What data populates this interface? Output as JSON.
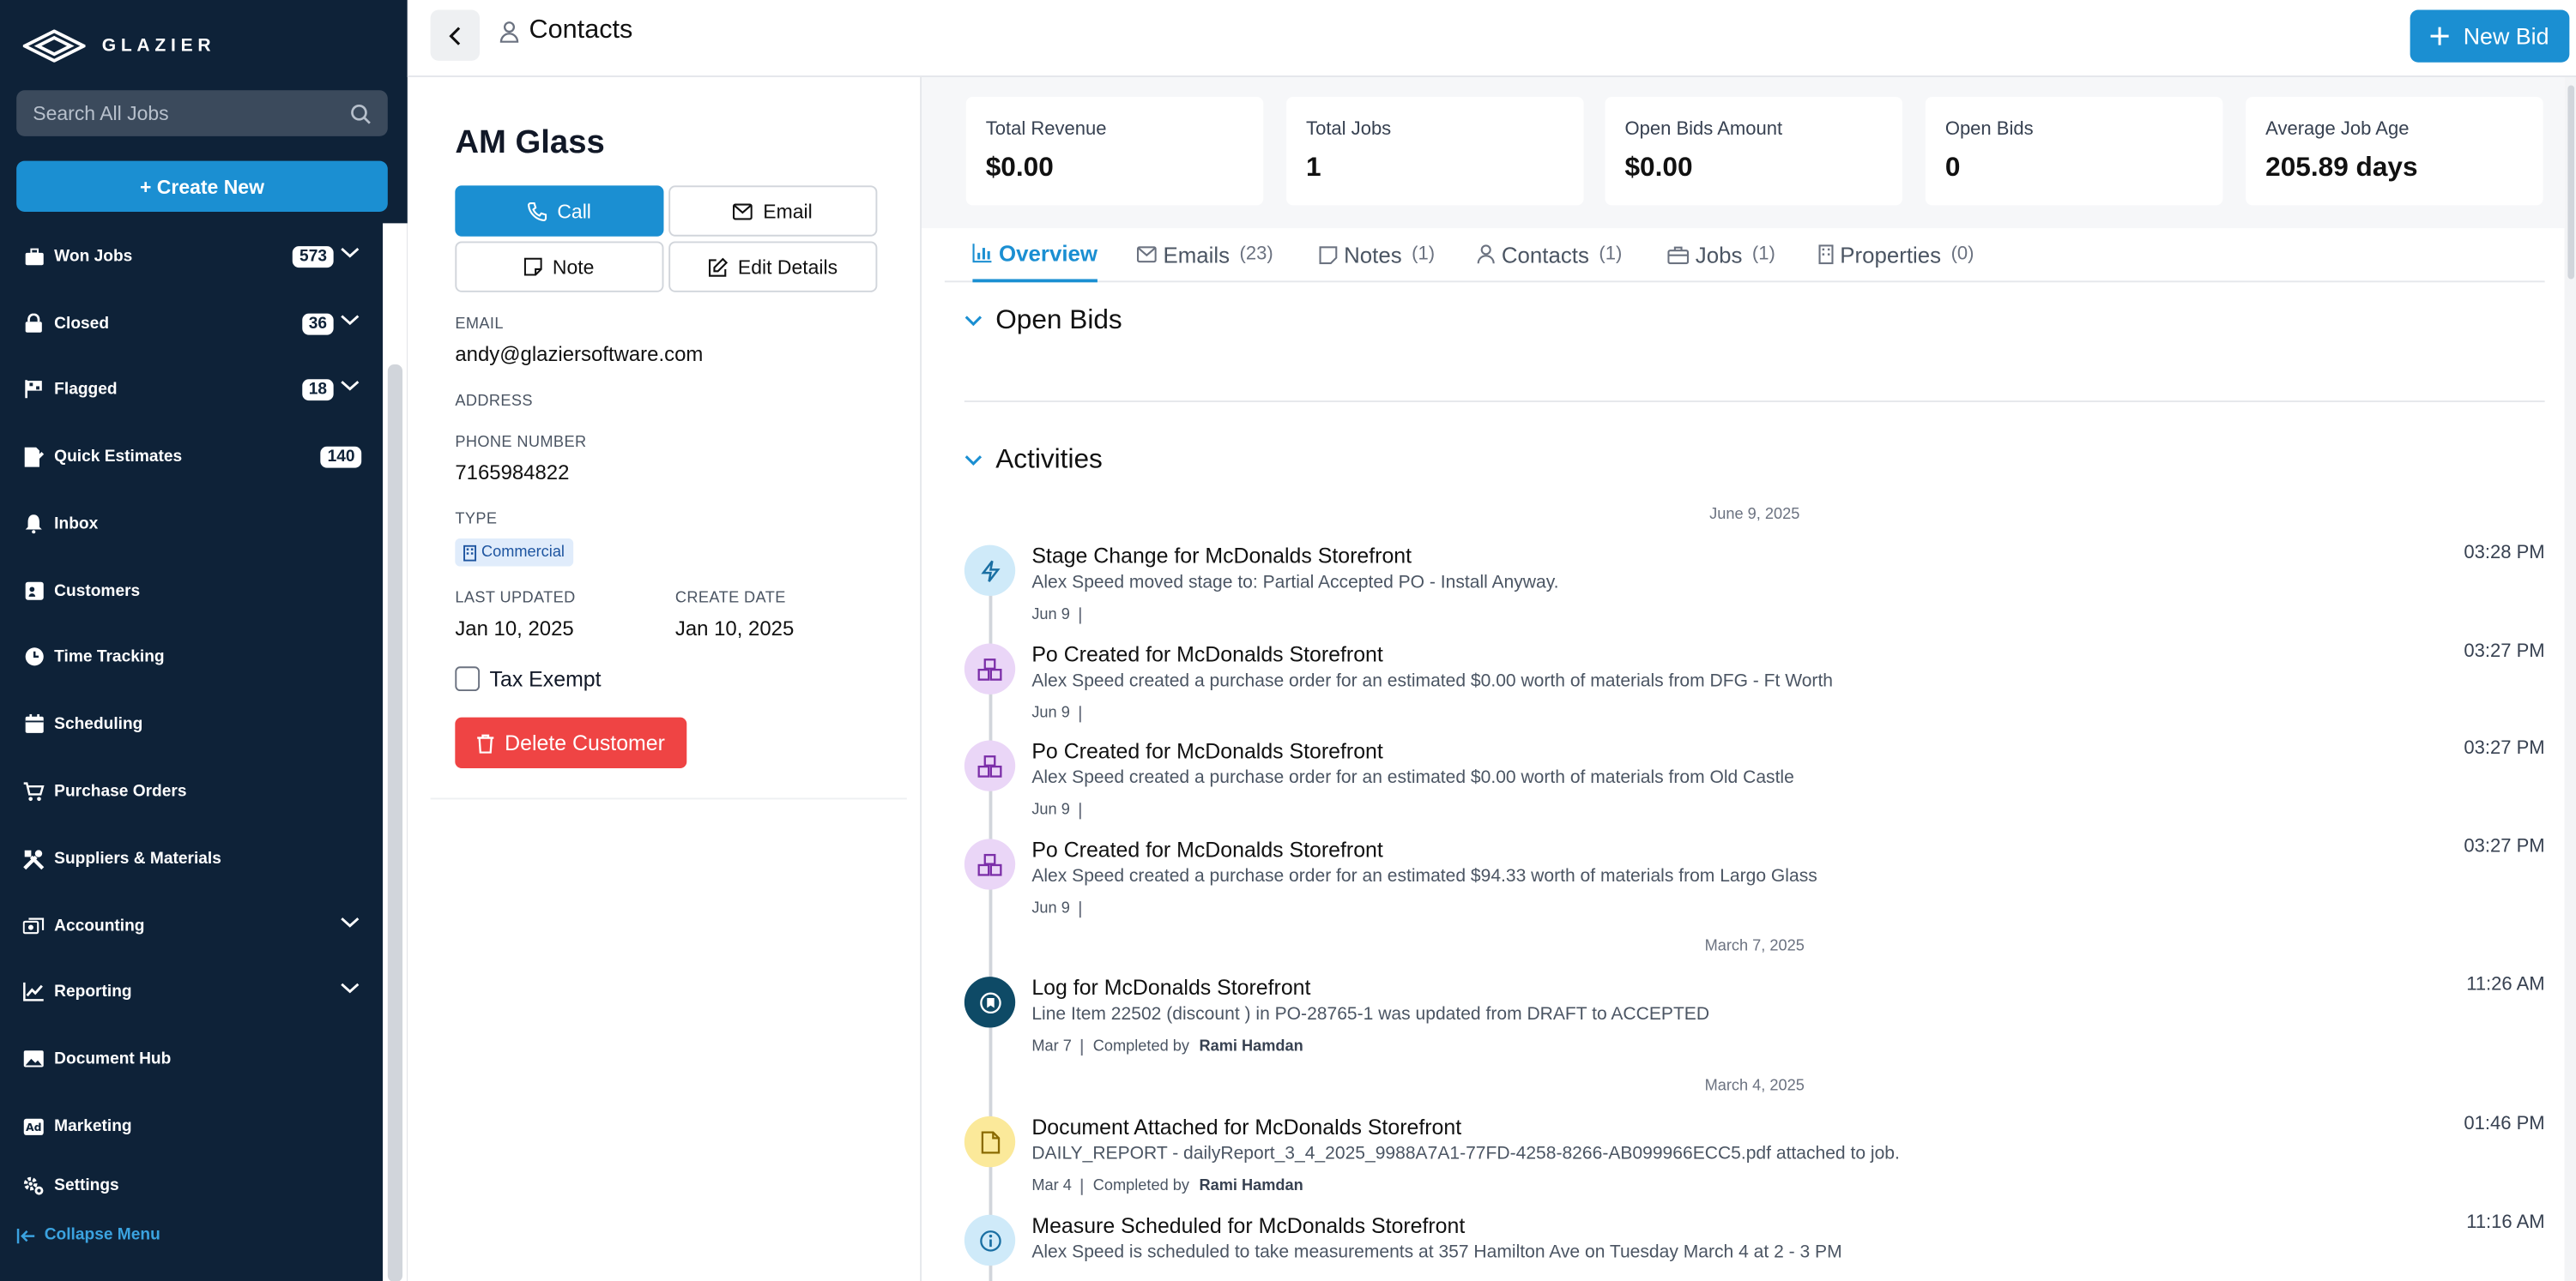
{
  "brand": {
    "name": "GLAZIER"
  },
  "sidebar": {
    "search_placeholder": "Search All Jobs",
    "create_label": "+ Create New",
    "items": [
      {
        "label": "Won Jobs",
        "badge": "573",
        "icon": "briefcase-icon"
      },
      {
        "label": "Closed",
        "badge": "36",
        "icon": "lock-icon"
      },
      {
        "label": "Flagged",
        "badge": "18",
        "icon": "flag-icon"
      },
      {
        "label": "Quick Estimates",
        "badge": "140",
        "icon": "estimate-icon"
      },
      {
        "label": "Inbox",
        "icon": "bell-icon"
      },
      {
        "label": "Customers",
        "icon": "contact-card-icon"
      },
      {
        "label": "Time Tracking",
        "icon": "clock-icon"
      },
      {
        "label": "Scheduling",
        "icon": "calendar-icon"
      },
      {
        "label": "Purchase Orders",
        "icon": "cart-icon"
      },
      {
        "label": "Suppliers & Materials",
        "icon": "tools-icon"
      },
      {
        "label": "Accounting",
        "icon": "accounting-icon"
      },
      {
        "label": "Reporting",
        "icon": "chart-icon"
      },
      {
        "label": "Document Hub",
        "icon": "image-icon"
      },
      {
        "label": "Marketing",
        "icon": "ad-icon"
      },
      {
        "label": "Settings",
        "icon": "gear-icon"
      }
    ],
    "collapse_label": "Collapse Menu"
  },
  "header": {
    "title": "Contacts",
    "new_bid_label": "New Bid"
  },
  "customer": {
    "name": "AM Glass",
    "buttons": {
      "call": "Call",
      "email": "Email",
      "note": "Note",
      "edit": "Edit Details"
    },
    "email_label": "EMAIL",
    "email": "andy@glaziersoftware.com",
    "address_label": "ADDRESS",
    "phone_label": "PHONE NUMBER",
    "phone": "7165984822",
    "type_label": "TYPE",
    "type": "Commercial",
    "last_updated_label": "LAST UPDATED",
    "last_updated": "Jan 10, 2025",
    "create_date_label": "CREATE DATE",
    "create_date": "Jan 10, 2025",
    "tax_exempt_label": "Tax Exempt",
    "delete_label": "Delete Customer"
  },
  "stats": [
    {
      "title": "Total Revenue",
      "value": "$0.00"
    },
    {
      "title": "Total Jobs",
      "value": "1"
    },
    {
      "title": "Open Bids Amount",
      "value": "$0.00"
    },
    {
      "title": "Open Bids",
      "value": "0"
    },
    {
      "title": "Average Job Age",
      "value": "205.89 days"
    }
  ],
  "tabs": [
    {
      "label": "Overview",
      "count": ""
    },
    {
      "label": "Emails",
      "count": "(23)"
    },
    {
      "label": "Notes",
      "count": "(1)"
    },
    {
      "label": "Contacts",
      "count": "(1)"
    },
    {
      "label": "Jobs",
      "count": "(1)"
    },
    {
      "label": "Properties",
      "count": "(0)"
    }
  ],
  "sections": {
    "open_bids": "Open Bids",
    "activities": "Activities"
  },
  "dates": [
    "June 9, 2025",
    "March 7, 2025",
    "March 4, 2025"
  ],
  "activities": [
    {
      "title": "Stage Change for McDonalds Storefront",
      "desc": "Alex Speed moved stage to: Partial Accepted PO - Install Anyway.",
      "date": "Jun 9",
      "completed_label": "",
      "completed_by": "",
      "time": "03:28 PM",
      "icon": "lightning-icon"
    },
    {
      "title": "Po Created for McDonalds Storefront",
      "desc": "Alex Speed created a purchase order for an estimated $0.00 worth of materials from DFG - Ft Worth",
      "date": "Jun 9",
      "completed_label": "",
      "completed_by": "",
      "time": "03:27 PM",
      "icon": "boxes-icon"
    },
    {
      "title": "Po Created for McDonalds Storefront",
      "desc": "Alex Speed created a purchase order for an estimated $0.00 worth of materials from Old Castle",
      "date": "Jun 9",
      "completed_label": "",
      "completed_by": "",
      "time": "03:27 PM",
      "icon": "boxes-icon"
    },
    {
      "title": "Po Created for McDonalds Storefront",
      "desc": "Alex Speed created a purchase order for an estimated $94.33 worth of materials from Largo Glass",
      "date": "Jun 9",
      "completed_label": "",
      "completed_by": "",
      "time": "03:27 PM",
      "icon": "boxes-icon"
    },
    {
      "title": "Log for McDonalds Storefront",
      "desc": "Line Item 22502 (discount ) in PO-28765-1 was updated from DRAFT to ACCEPTED",
      "date": "Mar 7",
      "completed_label": "Completed by",
      "completed_by": "Rami Hamdan",
      "time": "11:26 AM",
      "icon": "log-icon"
    },
    {
      "title": "Document Attached for McDonalds Storefront",
      "desc": "DAILY_REPORT - dailyReport_3_4_2025_9988A7A1-77FD-4258-8266-AB099966ECC5.pdf attached to job.",
      "date": "Mar 4",
      "completed_label": "Completed by",
      "completed_by": "Rami Hamdan",
      "time": "01:46 PM",
      "icon": "document-icon"
    },
    {
      "title": "Measure Scheduled for McDonalds Storefront",
      "desc": "Alex Speed is scheduled to take measurements at 357 Hamilton Ave on Tuesday March 4 at 2 - 3 PM",
      "date": "",
      "completed_label": "",
      "completed_by": "",
      "time": "11:16 AM",
      "icon": "info-icon"
    }
  ],
  "colors": {
    "sidebar": "#0e2238",
    "accent": "#1b8fd2",
    "danger": "#ef4444"
  }
}
